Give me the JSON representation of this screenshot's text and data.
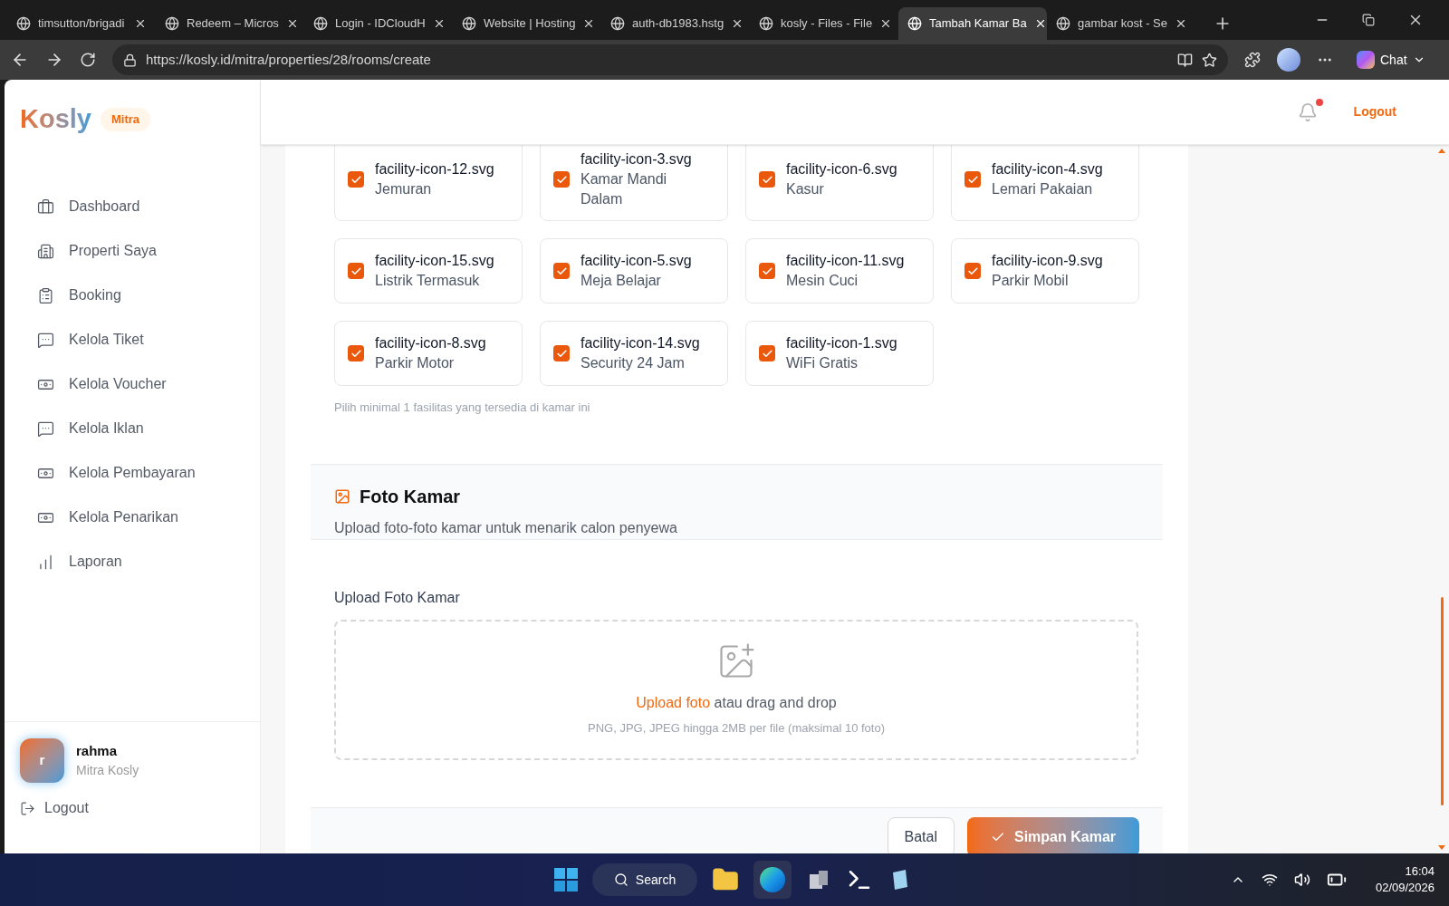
{
  "browser": {
    "tabs": [
      {
        "title": "timsutton/brigadi",
        "selected": false
      },
      {
        "title": "Redeem – Micros",
        "selected": false
      },
      {
        "title": "Login - IDCloudH",
        "selected": false
      },
      {
        "title": "Website | Hosting",
        "selected": false
      },
      {
        "title": "auth-db1983.hstg",
        "selected": false
      },
      {
        "title": "kosly - Files - File",
        "selected": false
      },
      {
        "title": "Tambah Kamar Ba",
        "selected": true
      },
      {
        "title": "gambar kost - Se",
        "selected": false
      }
    ],
    "url": "https://kosly.id/mitra/properties/28/rooms/create",
    "chat": "Chat"
  },
  "sidebar": {
    "logo": "Kosly",
    "badge": "Mitra",
    "items": [
      {
        "label": "Dashboard"
      },
      {
        "label": "Properti Saya"
      },
      {
        "label": "Booking"
      },
      {
        "label": "Kelola Tiket"
      },
      {
        "label": "Kelola Voucher"
      },
      {
        "label": "Kelola Iklan"
      },
      {
        "label": "Kelola Pembayaran"
      },
      {
        "label": "Kelola Penarikan"
      },
      {
        "label": "Laporan"
      }
    ],
    "user": {
      "initial": "r",
      "name": "rahma",
      "role": "Mitra Kosly"
    },
    "logout": "Logout"
  },
  "header": {
    "unread": true,
    "logout": "Logout"
  },
  "facilities": {
    "items": [
      {
        "file": "facility-icon-12.svg",
        "name": "Jemuran",
        "checked": true
      },
      {
        "file": "facility-icon-3.svg",
        "name": "Kamar Mandi Dalam",
        "checked": true
      },
      {
        "file": "facility-icon-6.svg",
        "name": "Kasur",
        "checked": true
      },
      {
        "file": "facility-icon-4.svg",
        "name": "Lemari Pakaian",
        "checked": true
      },
      {
        "file": "facility-icon-15.svg",
        "name": "Listrik Termasuk",
        "checked": true
      },
      {
        "file": "facility-icon-5.svg",
        "name": "Meja Belajar",
        "checked": true
      },
      {
        "file": "facility-icon-11.svg",
        "name": "Mesin Cuci",
        "checked": true
      },
      {
        "file": "facility-icon-9.svg",
        "name": "Parkir Mobil",
        "checked": true
      },
      {
        "file": "facility-icon-8.svg",
        "name": "Parkir Motor",
        "checked": true
      },
      {
        "file": "facility-icon-14.svg",
        "name": "Security 24 Jam",
        "checked": true
      },
      {
        "file": "facility-icon-1.svg",
        "name": "WiFi Gratis",
        "checked": true
      }
    ],
    "hint": "Pilih minimal 1 fasilitas yang tersedia di kamar ini"
  },
  "photo_section": {
    "title": "Foto Kamar",
    "subtitle": "Upload foto-foto kamar untuk menarik calon penyewa",
    "label": "Upload Foto Kamar",
    "upload_link": "Upload foto",
    "upload_text": "atau drag and drop",
    "hint": "PNG, JPG, JPEG hingga 2MB per file (maksimal 10 foto)"
  },
  "actions": {
    "cancel": "Batal",
    "submit": "Simpan Kamar"
  },
  "taskbar": {
    "search": "Search",
    "time": "16:04",
    "date": "02/09/2026"
  }
}
